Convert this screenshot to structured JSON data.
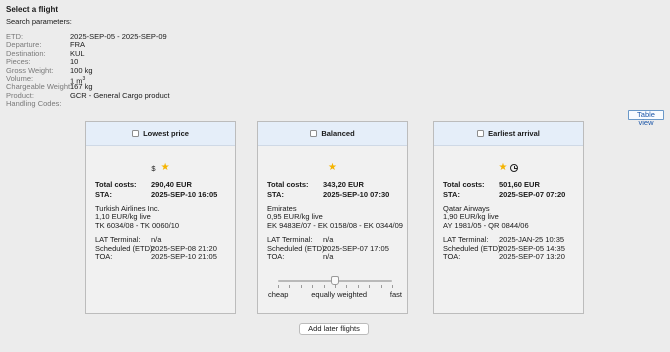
{
  "title": "Select a flight",
  "subtitle": "Search parameters:",
  "params": [
    {
      "label": "ETD:",
      "value": "2025-SEP-05 - 2025-SEP-09"
    },
    {
      "label": "Departure:",
      "value": "FRA"
    },
    {
      "label": "Destination:",
      "value": "KUL"
    },
    {
      "label": "Pieces:",
      "value": "10"
    },
    {
      "label": "Gross Weight:",
      "value": "100 kg"
    },
    {
      "label": "Volume:",
      "value": "1 m",
      "sup": "3"
    },
    {
      "label": "Chargeable Weight:",
      "value": "167 kg"
    },
    {
      "label": "Product:",
      "value": "GCR - General Cargo product"
    },
    {
      "label": "Handling Codes:",
      "value": ""
    }
  ],
  "table_view_label": "Table view",
  "labels": {
    "total": "Total costs:",
    "sta": "STA:",
    "lat": "LAT Terminal:",
    "sched": "Scheduled (ETD):",
    "toa": "TOA:"
  },
  "icons": {
    "dollar": "$",
    "star": "★",
    "clock": "clock-icon",
    "star_color": "#f5b400"
  },
  "cards": [
    {
      "title": "Lowest price",
      "total": "290,40 EUR",
      "sta": "2025-SEP-10 16:05",
      "airline": "Turkish Airlines Inc.",
      "rate": "1,10 EUR/kg live",
      "route": "TK 6034/08 - TK 0060/10",
      "lat": "n/a",
      "sched": "2025-SEP-08 21:20",
      "toa": "2025-SEP-10 21:05"
    },
    {
      "title": "Balanced",
      "total": "343,20 EUR",
      "sta": "2025-SEP-10 07:30",
      "airline": "Emirates",
      "rate": "0,95 EUR/kg live",
      "route": "EK 9483E/07 - EK 0158/08 - EK 0344/09",
      "lat": "n/a",
      "sched": "2025-SEP-07 17:05",
      "toa": "n/a"
    },
    {
      "title": "Earliest arrival",
      "total": "501,60 EUR",
      "sta": "2025-SEP-07 07:20",
      "airline": "Qatar Airways",
      "rate": "1,90 EUR/kg live",
      "route": "AY 1981/05 - QR 0844/06",
      "lat": "2025-JAN-25 10:35",
      "sched": "2025-SEP-05 14:35",
      "toa": "2025-SEP-07 13:20"
    }
  ],
  "slider": {
    "left": "cheap",
    "middle": "equally weighted",
    "right": "fast",
    "value": 0.5
  },
  "add_later_label": "Add later flights"
}
